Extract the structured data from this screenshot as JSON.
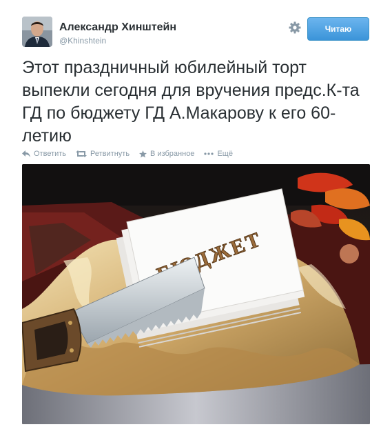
{
  "tweet": {
    "author_name": "Александр Хинштейн",
    "author_handle": "@Khinshtein",
    "follow_button_label": "Читаю",
    "text": "Этот праздничный юбилейный торт выпекли сегодня для вручения  предс.К-та ГД по бюджету ГД А.Макарову к его 60-летию",
    "actions": {
      "reply": "Ответить",
      "retweet": "Ретвитнуть",
      "favorite": "В избранное",
      "more": "Ещё"
    },
    "photo": {
      "cake_lettering": "БЮДЖЕТ"
    }
  },
  "icons": [
    "settings-gear-icon",
    "reply-icon",
    "retweet-icon",
    "favorite-star-icon",
    "more-dots-icon"
  ],
  "colors": {
    "follow_button": "#3b94d9",
    "secondary_text": "#8899a6",
    "primary_text": "#292f33"
  }
}
